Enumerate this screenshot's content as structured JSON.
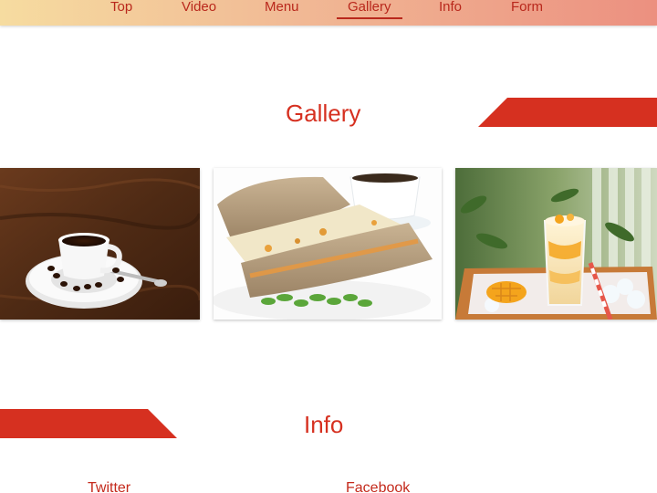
{
  "nav": {
    "items": [
      {
        "label": "Top"
      },
      {
        "label": "Video"
      },
      {
        "label": "Menu"
      },
      {
        "label": "Gallery"
      },
      {
        "label": "Info"
      },
      {
        "label": "Form"
      }
    ],
    "active": "Gallery"
  },
  "gallery": {
    "title": "Gallery",
    "photos": [
      {
        "subject": "coffee cup on saucer with coffee beans on wooden table"
      },
      {
        "subject": "whole grain sandwich with cress and coffee cup"
      },
      {
        "subject": "mango smoothie with straw on wooden tray"
      }
    ]
  },
  "info": {
    "title": "Info",
    "links": [
      {
        "label": "Twitter"
      },
      {
        "label": "Facebook"
      }
    ]
  },
  "colors": {
    "accent": "#d63020",
    "nav_gradient_start": "#f6dca0",
    "nav_gradient_end": "#ec9080"
  }
}
